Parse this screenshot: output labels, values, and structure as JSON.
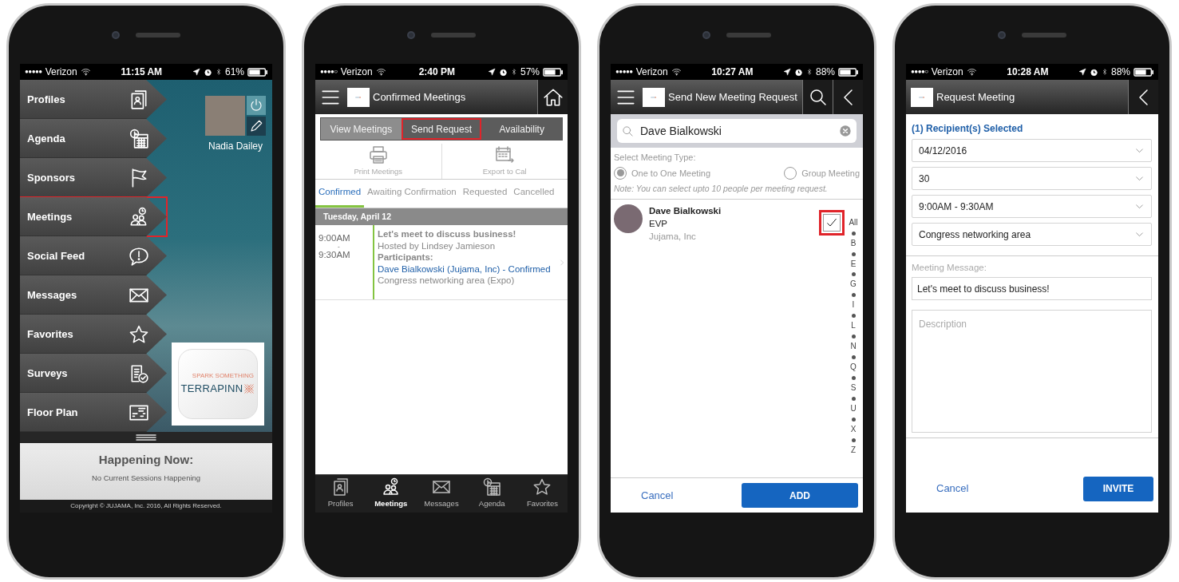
{
  "phones": [
    {
      "kind": "menu",
      "status": {
        "signal": "●●●●●",
        "carrier": "Verizon",
        "time": "11:15 AM",
        "battery": "61%"
      },
      "menu_items": [
        {
          "label": "Profiles",
          "highlighted": false
        },
        {
          "label": "Agenda",
          "highlighted": false
        },
        {
          "label": "Sponsors",
          "highlighted": false
        },
        {
          "label": "Meetings",
          "highlighted": true
        },
        {
          "label": "Social Feed",
          "highlighted": false
        },
        {
          "label": "Messages",
          "highlighted": false
        },
        {
          "label": "Favorites",
          "highlighted": false
        },
        {
          "label": "Surveys",
          "highlighted": false
        },
        {
          "label": "Floor Plan",
          "highlighted": false
        }
      ],
      "profile": {
        "name": "Nadia Dailey"
      },
      "logo": {
        "tagline": "SPARK SOMETHING",
        "name": "TERRAPINN"
      },
      "happening": {
        "title": "Happening Now:",
        "text": "No Current Sessions Happening"
      },
      "copyright": "Copyright © JUJAMA, Inc. 2016, All Rights Reserved."
    },
    {
      "kind": "meetings",
      "status": {
        "signal": "●●●●○",
        "carrier": "Verizon",
        "time": "2:40 PM",
        "battery": "57%"
      },
      "header": {
        "title": "Confirmed Meetings"
      },
      "segments": [
        {
          "label": "View Meetings",
          "selected": true,
          "highlighted": false
        },
        {
          "label": "Send Request",
          "selected": false,
          "highlighted": true
        },
        {
          "label": "Availability",
          "selected": false,
          "highlighted": false
        }
      ],
      "actions": [
        "Print Meetings",
        "Export to Cal"
      ],
      "tabs": [
        {
          "label": "Confirmed",
          "selected": true
        },
        {
          "label": "Awaiting Confirmation",
          "selected": false
        },
        {
          "label": "Requested",
          "selected": false
        },
        {
          "label": "Cancelled",
          "selected": false
        }
      ],
      "date": "Tuesday, April 12",
      "meeting": {
        "start": "9:00AM",
        "separator": "-",
        "end": "9:30AM",
        "title": "Let's meet to discuss business!",
        "host": "Hosted by Lindsey Jamieson",
        "participants_label": "Participants:",
        "participant": "Dave Bialkowski (Jujama, Inc) - Confirmed",
        "location": "Congress networking area (Expo)"
      },
      "tab_bar": [
        {
          "label": "Profiles",
          "selected": false
        },
        {
          "label": "Meetings",
          "selected": true
        },
        {
          "label": "Messages",
          "selected": false
        },
        {
          "label": "Agenda",
          "selected": false
        },
        {
          "label": "Favorites",
          "selected": false
        }
      ]
    },
    {
      "kind": "search",
      "status": {
        "signal": "●●●●●",
        "carrier": "Verizon",
        "time": "10:27 AM",
        "battery": "88%"
      },
      "header": {
        "title": "Send New Meeting Request"
      },
      "search": {
        "value": "Dave Bialkowski"
      },
      "type_label": "Select Meeting Type:",
      "meeting_types": [
        {
          "label": "One to One Meeting",
          "selected": true
        },
        {
          "label": "Group Meeting",
          "selected": false
        }
      ],
      "note": "Note: You can select upto 10 people per meeting request.",
      "contacts": [
        {
          "name": "Dave Bialkowski",
          "title": "EVP",
          "company": "Jujama, Inc",
          "checked": true,
          "highlighted": true
        }
      ],
      "index": [
        "All",
        "B",
        "E",
        "G",
        "I",
        "L",
        "N",
        "Q",
        "S",
        "U",
        "X",
        "Z"
      ],
      "cancel": "Cancel",
      "confirm": "ADD"
    },
    {
      "kind": "request",
      "status": {
        "signal": "●●●●○",
        "carrier": "Verizon",
        "time": "10:28 AM",
        "battery": "88%"
      },
      "header": {
        "title": "Request Meeting"
      },
      "recipients": "(1) Recipient(s) Selected",
      "selects": [
        "04/12/2016",
        "30",
        "9:00AM - 9:30AM",
        "Congress networking area"
      ],
      "message_label": "Meeting Message:",
      "message": {
        "value": "Let's meet to discuss business!"
      },
      "description": {
        "placeholder": "Description"
      },
      "cancel": "Cancel",
      "confirm": "INVITE"
    }
  ]
}
